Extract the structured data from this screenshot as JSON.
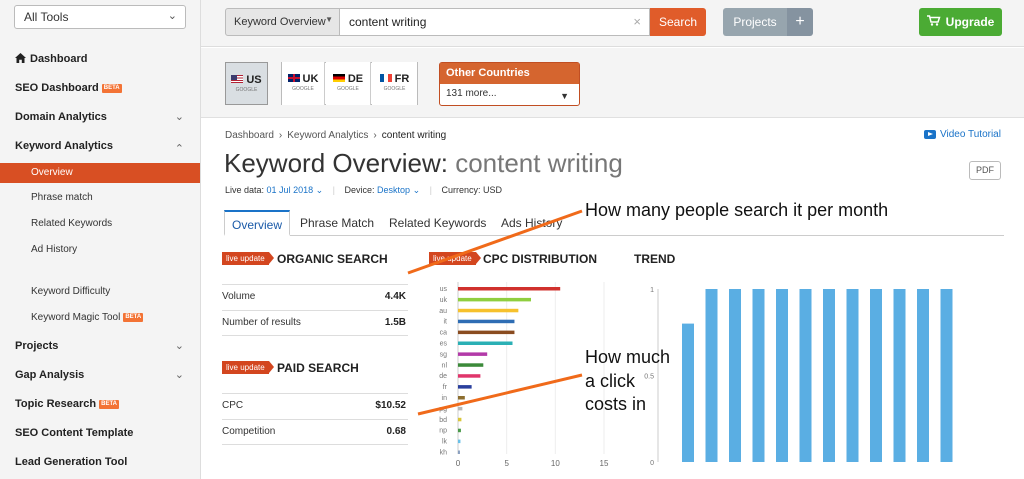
{
  "sidebar": {
    "tools_select": "All Tools",
    "items": [
      {
        "label": "Dashboard",
        "icon": "home-icon"
      },
      {
        "label": "SEO Dashboard",
        "badge": "BETA"
      },
      {
        "label": "Domain Analytics"
      },
      {
        "label": "Keyword Analytics"
      },
      {
        "label": "Projects"
      },
      {
        "label": "Gap Analysis"
      },
      {
        "label": "Topic Research",
        "badge": "BETA"
      },
      {
        "label": "SEO Content Template"
      },
      {
        "label": "Lead Generation Tool"
      }
    ],
    "keyword_sub": [
      {
        "label": "Overview"
      },
      {
        "label": "Phrase match"
      },
      {
        "label": "Related Keywords"
      },
      {
        "label": "Ad History"
      },
      {
        "label": "Keyword Difficulty"
      },
      {
        "label": "Keyword Magic Tool",
        "badge": "BETA"
      }
    ]
  },
  "topbar": {
    "db_select": "Keyword Overview",
    "search_value": "content writing",
    "search_button": "Search",
    "projects_button": "Projects",
    "plus_button": "+",
    "upgrade_button": "Upgrade"
  },
  "databases": {
    "countries": [
      {
        "code": "US",
        "engine": "GOOGLE"
      },
      {
        "code": "UK",
        "engine": "GOOGLE"
      },
      {
        "code": "DE",
        "engine": "GOOGLE"
      },
      {
        "code": "FR",
        "engine": "GOOGLE"
      }
    ],
    "other_title": "Other Countries",
    "other_value": "131 more..."
  },
  "breadcrumb": [
    "Dashboard",
    "Keyword Analytics",
    "content writing"
  ],
  "video_tutorial": "Video Tutorial",
  "page_title_prefix": "Keyword Overview:",
  "page_title_keyword": "content writing",
  "pdf_button": "PDF",
  "meta": {
    "live_label": "Live data:",
    "live_date": "01 Jul 2018",
    "device_label": "Device:",
    "device_value": "Desktop",
    "currency_label": "Currency: USD"
  },
  "tabs": [
    "Overview",
    "Phrase Match",
    "Related Keywords",
    "Ads History"
  ],
  "live_update": "live update",
  "organic": {
    "title": "ORGANIC SEARCH",
    "rows": [
      {
        "label": "Volume",
        "value": "4.4K"
      },
      {
        "label": "Number of results",
        "value": "1.5B"
      }
    ]
  },
  "paid": {
    "title": "PAID SEARCH",
    "rows": [
      {
        "label": "CPC",
        "value": "$10.52"
      },
      {
        "label": "Competition",
        "value": "0.68"
      }
    ]
  },
  "cpc_title": "CPC DISTRIBUTION",
  "trend_title": "TREND",
  "annotations": {
    "search": "How many people search it per month",
    "cost_line1": "How much",
    "cost_line2": "a click",
    "cost_line3": "costs in"
  },
  "colors": {
    "accent": "#d84f23",
    "link": "#1a73c8",
    "upgrade": "#4bab34",
    "trend_bar": "#5aaee3"
  },
  "chart_data": [
    {
      "type": "bar",
      "title": "CPC DISTRIBUTION",
      "orientation": "horizontal",
      "categories": [
        "us",
        "uk",
        "au",
        "it",
        "ca",
        "es",
        "sg",
        "nl",
        "de",
        "fr",
        "in",
        "pg",
        "bd",
        "np",
        "lk",
        "kh"
      ],
      "values": [
        10.5,
        7.5,
        6.2,
        5.8,
        5.8,
        5.6,
        3.0,
        2.6,
        2.3,
        1.4,
        0.7,
        0.45,
        0.35,
        0.3,
        0.25,
        0.2
      ],
      "colors": [
        "#d0312d",
        "#8fce3f",
        "#f6c12d",
        "#2e6db4",
        "#8a4c20",
        "#2bb0b5",
        "#b23aa8",
        "#3c8a3a",
        "#e0356b",
        "#2a3f9d",
        "#8d6e2f",
        "#b7b7b7",
        "#d9c63a",
        "#4a9a4a",
        "#69c0e8",
        "#8aa0c0"
      ],
      "xticks": [
        0,
        5,
        10,
        15
      ],
      "xlim": [
        0,
        15
      ]
    },
    {
      "type": "bar",
      "title": "TREND",
      "values": [
        0.8,
        1,
        1,
        1,
        1,
        1,
        1,
        1,
        1,
        1,
        1,
        1
      ],
      "yticks": [
        "1",
        "0.5",
        "0"
      ],
      "ylim": [
        0,
        1
      ]
    }
  ]
}
